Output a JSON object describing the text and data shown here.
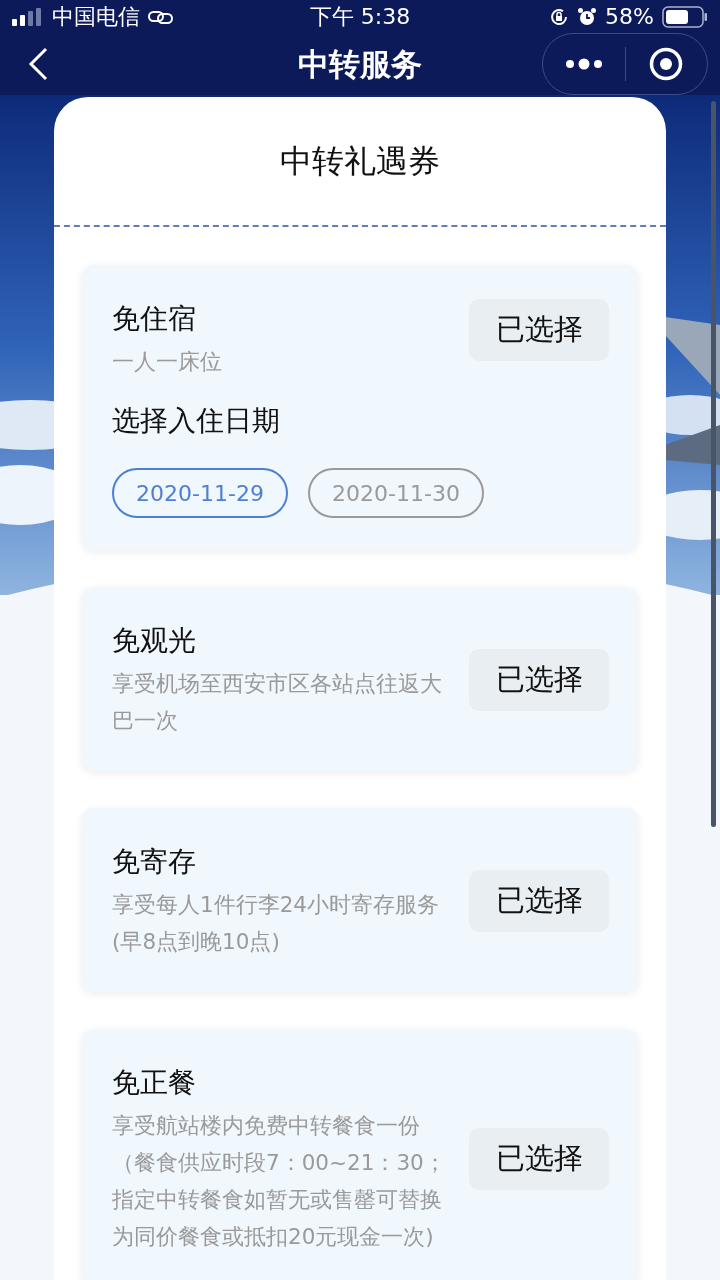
{
  "status_bar": {
    "carrier": "中国电信",
    "time": "下午 5:38",
    "battery": "58%"
  },
  "nav": {
    "title": "中转服务"
  },
  "sheet": {
    "title": "中转礼遇券",
    "coupons": [
      {
        "title": "免住宿",
        "desc": "一人一床位",
        "button": "已选择",
        "date_picker": {
          "label": "选择入住日期",
          "dates": [
            {
              "label": "2020-11-29",
              "selected": true
            },
            {
              "label": "2020-11-30",
              "selected": false
            }
          ]
        }
      },
      {
        "title": "免观光",
        "desc": "享受机场至西安市区各站点往返大巴一次",
        "button": "已选择"
      },
      {
        "title": "免寄存",
        "desc": "享受每人1件行李24小时寄存服务(早8点到晚10点)",
        "button": "已选择"
      },
      {
        "title": "免正餐",
        "desc": "享受航站楼内免费中转餐食一份（餐食供应时段7：00~21：30；指定中转餐食如暂无或售罄可替换为同价餐食或抵扣20元现金一次)",
        "button": "已选择"
      }
    ]
  }
}
